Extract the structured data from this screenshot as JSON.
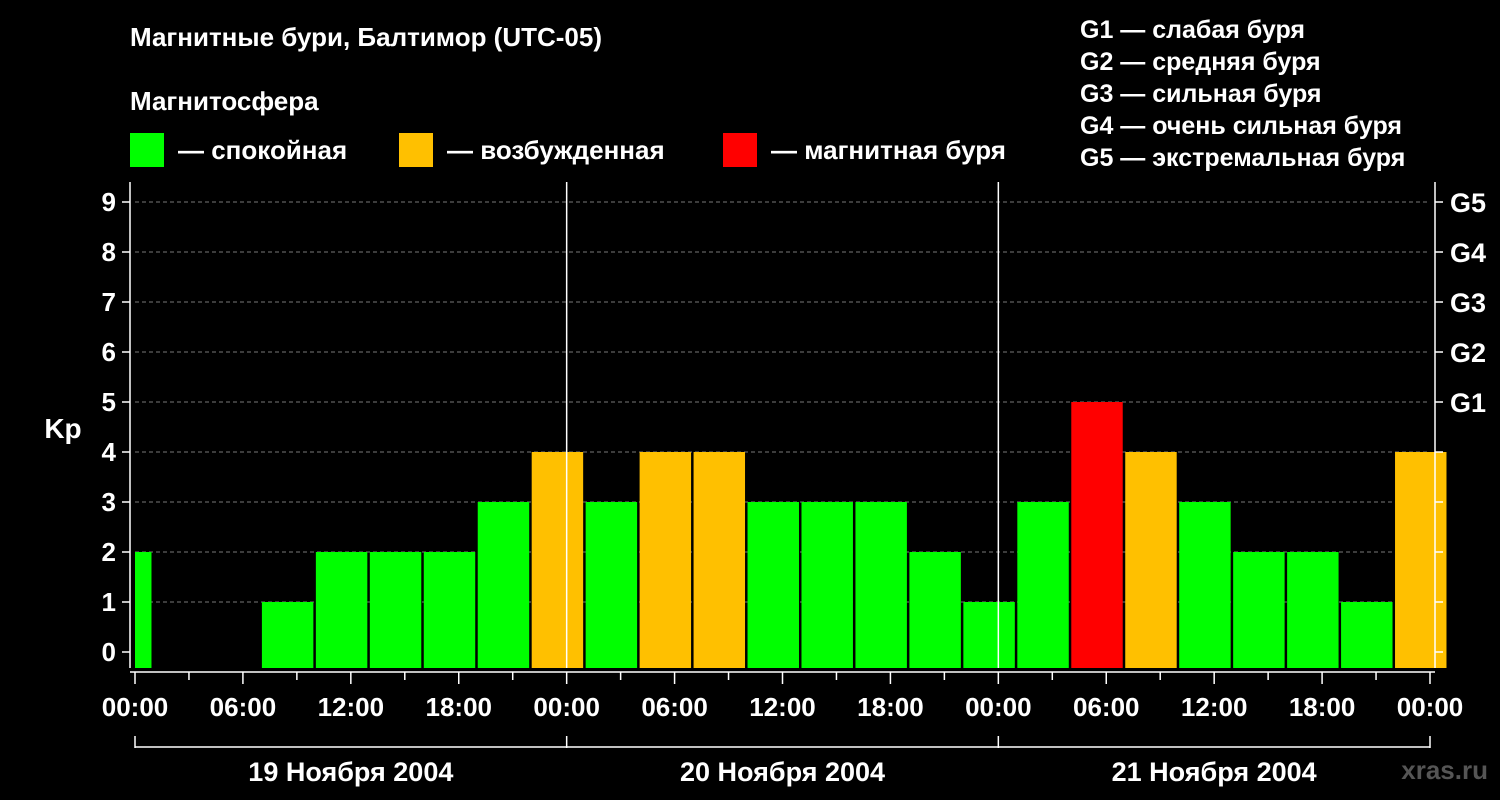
{
  "header": {
    "title": "Магнитные бури, Балтимор (UTC-05)",
    "legend_title": "Магнитосфера"
  },
  "legend": [
    {
      "label": "— спокойная",
      "color": "#00ff00"
    },
    {
      "label": "— возбужденная",
      "color": "#ffc000"
    },
    {
      "label": "— магнитная буря",
      "color": "#ff0000"
    }
  ],
  "storm_scale": [
    "G1 — слабая буря",
    "G2 — средняя буря",
    "G3 — сильная буря",
    "G4 — очень сильная буря",
    "G5 — экстремальная буря"
  ],
  "watermark": "xras.ru",
  "chart_data": {
    "type": "bar",
    "ylabel": "Kp",
    "ylim": [
      0,
      9
    ],
    "yticks": [
      "0",
      "1",
      "2",
      "3",
      "4",
      "5",
      "6",
      "7",
      "8",
      "9"
    ],
    "right_ticks": [
      {
        "value": 5,
        "label": "G1"
      },
      {
        "value": 6,
        "label": "G2"
      },
      {
        "value": 7,
        "label": "G3"
      },
      {
        "value": 8,
        "label": "G4"
      },
      {
        "value": 9,
        "label": "G5"
      }
    ],
    "xticks": [
      "00:00",
      "06:00",
      "12:00",
      "18:00",
      "00:00",
      "06:00",
      "12:00",
      "18:00",
      "00:00",
      "06:00",
      "12:00",
      "18:00",
      "00:00"
    ],
    "days": [
      "19 Ноября 2004",
      "20 Ноября 2004",
      "21 Ноября 2004"
    ],
    "grid": true,
    "colors": {
      "quiet": "#00ff00",
      "active": "#ffc000",
      "storm": "#ff0000"
    },
    "start_hour": 0.1,
    "bars": [
      {
        "start_hour": -2,
        "kp": 2
      },
      {
        "start_hour": 1,
        "kp": 0
      },
      {
        "start_hour": 4,
        "kp": 0
      },
      {
        "start_hour": 7,
        "kp": 1
      },
      {
        "start_hour": 10,
        "kp": 2
      },
      {
        "start_hour": 13,
        "kp": 2
      },
      {
        "start_hour": 16,
        "kp": 2
      },
      {
        "start_hour": 19,
        "kp": 3
      },
      {
        "start_hour": 22,
        "kp": 4
      },
      {
        "start_hour": 25,
        "kp": 3
      },
      {
        "start_hour": 28,
        "kp": 4
      },
      {
        "start_hour": 31,
        "kp": 4
      },
      {
        "start_hour": 34,
        "kp": 3
      },
      {
        "start_hour": 37,
        "kp": 3
      },
      {
        "start_hour": 40,
        "kp": 3
      },
      {
        "start_hour": 43,
        "kp": 2
      },
      {
        "start_hour": 46,
        "kp": 1
      },
      {
        "start_hour": 49,
        "kp": 3
      },
      {
        "start_hour": 52,
        "kp": 5
      },
      {
        "start_hour": 55,
        "kp": 4
      },
      {
        "start_hour": 58,
        "kp": 3
      },
      {
        "start_hour": 61,
        "kp": 2
      },
      {
        "start_hour": 64,
        "kp": 2
      },
      {
        "start_hour": 67,
        "kp": 1
      },
      {
        "start_hour": 70,
        "kp": 4
      }
    ]
  }
}
